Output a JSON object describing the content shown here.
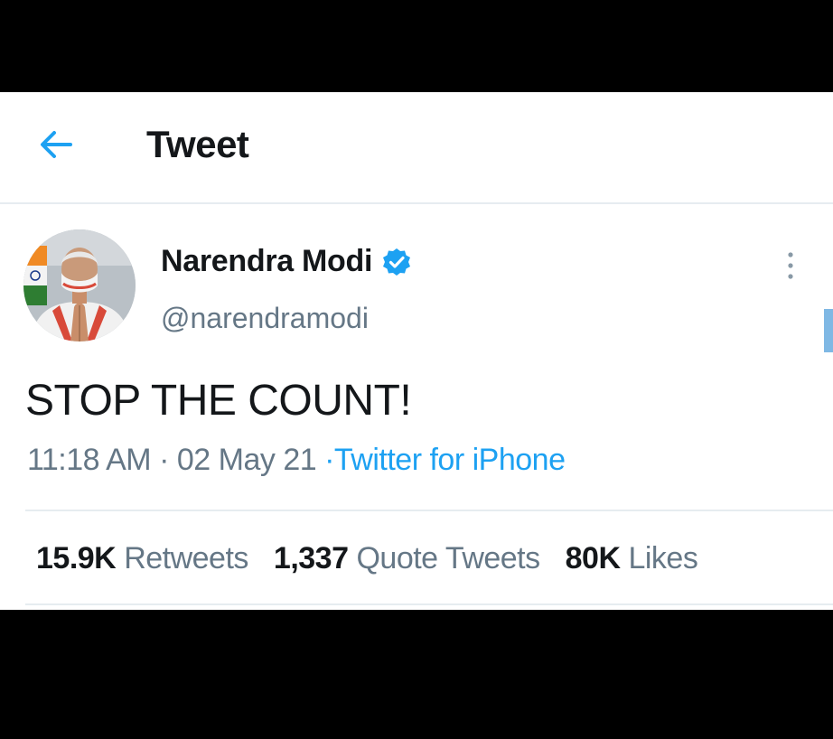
{
  "header": {
    "title": "Tweet",
    "back_icon": "arrow-left-icon"
  },
  "tweet": {
    "display_name": "Narendra Modi",
    "verified_icon": "verified-badge-icon",
    "handle": "@narendramodi",
    "more_icon": "more-vertical-icon",
    "text": "STOP THE COUNT!",
    "time": "11:18 AM",
    "separator": "·",
    "date": "02 May 21",
    "source": "·Twitter for iPhone"
  },
  "stats": {
    "retweets_count": "15.9K",
    "retweets_label": "Retweets",
    "quote_count": "1,337",
    "quote_label": "Quote Tweets",
    "likes_count": "80K",
    "likes_label": "Likes"
  },
  "colors": {
    "accent": "#1da1f2",
    "text_primary": "#14171a",
    "text_secondary": "#657786",
    "divider": "#e6ecf0"
  }
}
